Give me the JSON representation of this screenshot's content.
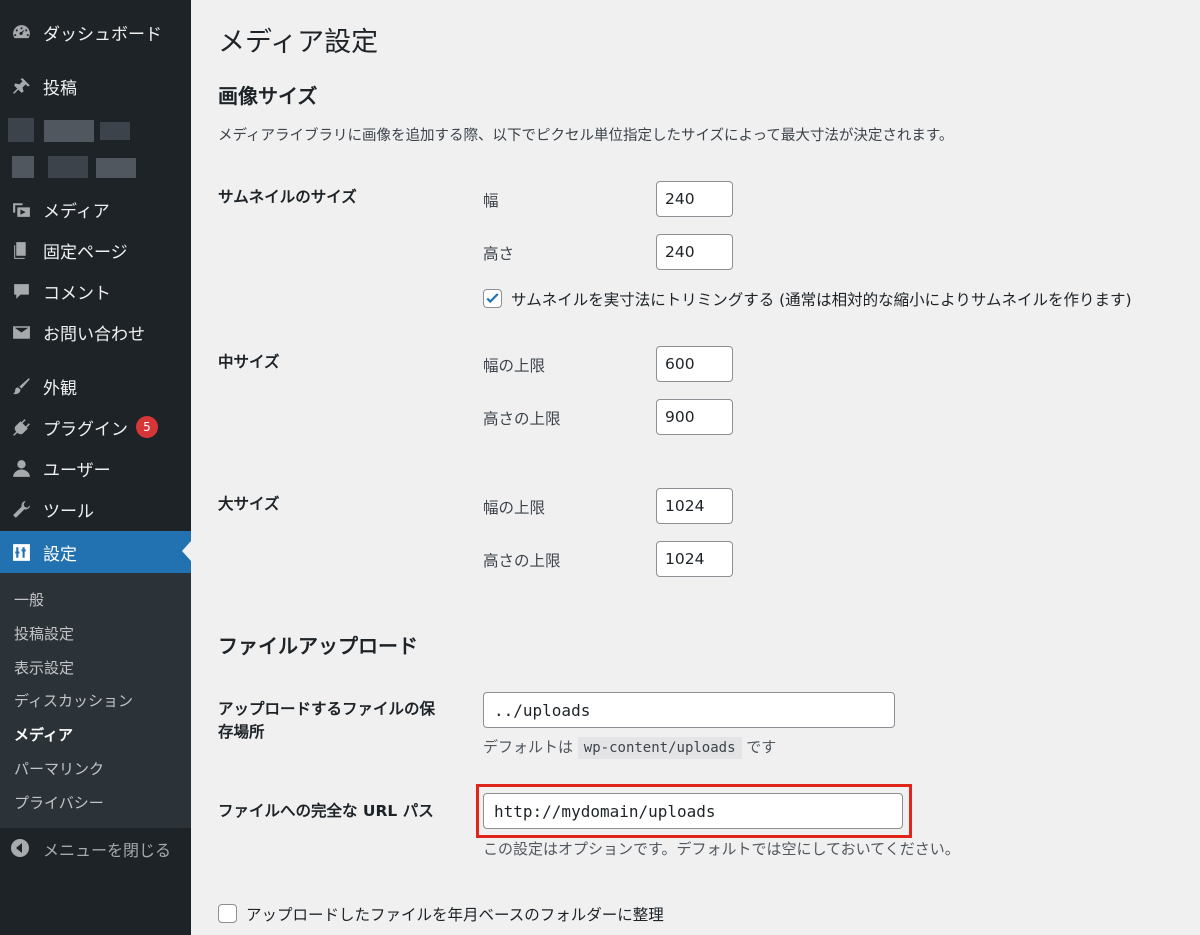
{
  "sidebar": {
    "items": [
      {
        "label": "ダッシュボード",
        "icon": "dashboard-icon"
      },
      {
        "label": "投稿",
        "icon": "pin-icon"
      },
      {
        "label": "メディア",
        "icon": "media-icon"
      },
      {
        "label": "固定ページ",
        "icon": "pages-icon"
      },
      {
        "label": "コメント",
        "icon": "comment-icon"
      },
      {
        "label": "お問い合わせ",
        "icon": "mail-icon"
      },
      {
        "label": "外観",
        "icon": "brush-icon"
      },
      {
        "label": "プラグイン",
        "icon": "plugin-icon",
        "badge": "5"
      },
      {
        "label": "ユーザー",
        "icon": "user-icon"
      },
      {
        "label": "ツール",
        "icon": "wrench-icon"
      },
      {
        "label": "設定",
        "icon": "settings-icon"
      }
    ],
    "submenu": [
      "一般",
      "投稿設定",
      "表示設定",
      "ディスカッション",
      "メディア",
      "パーマリンク",
      "プライバシー"
    ],
    "collapse_label": "メニューを閉じる"
  },
  "main": {
    "page_title": "メディア設定",
    "image_sizes": {
      "title": "画像サイズ",
      "description": "メディアライブラリに画像を追加する際、以下でピクセル単位指定したサイズによって最大寸法が決定されます。",
      "thumbnail": {
        "label": "サムネイルのサイズ",
        "width_label": "幅",
        "width_value": "240",
        "height_label": "高さ",
        "height_value": "240",
        "crop_label": "サムネイルを実寸法にトリミングする (通常は相対的な縮小によりサムネイルを作ります)",
        "crop_checked": true
      },
      "medium": {
        "label": "中サイズ",
        "width_label": "幅の上限",
        "width_value": "600",
        "height_label": "高さの上限",
        "height_value": "900"
      },
      "large": {
        "label": "大サイズ",
        "width_label": "幅の上限",
        "width_value": "1024",
        "height_label": "高さの上限",
        "height_value": "1024"
      }
    },
    "uploads": {
      "title": "ファイルアップロード",
      "path_label_line1": "アップロードするファイルの保",
      "path_label_line2": "存場所",
      "path_value": "../uploads",
      "path_help_prefix": "デフォルトは",
      "path_help_code": "wp-content/uploads",
      "path_help_suffix": "です",
      "url_label": "ファイルへの完全な URL パス",
      "url_value": "http://mydomain/uploads",
      "url_help": "この設定はオプションです。デフォルトでは空にしておいてください。",
      "organize_label": "アップロードしたファイルを年月ベースのフォルダーに整理",
      "organize_checked": false
    }
  },
  "colors": {
    "sidebar_bg": "#1d2327",
    "active_bg": "#2271b1",
    "badge": "#d63638",
    "highlight": "#e0251b",
    "check": "#2271b1"
  }
}
